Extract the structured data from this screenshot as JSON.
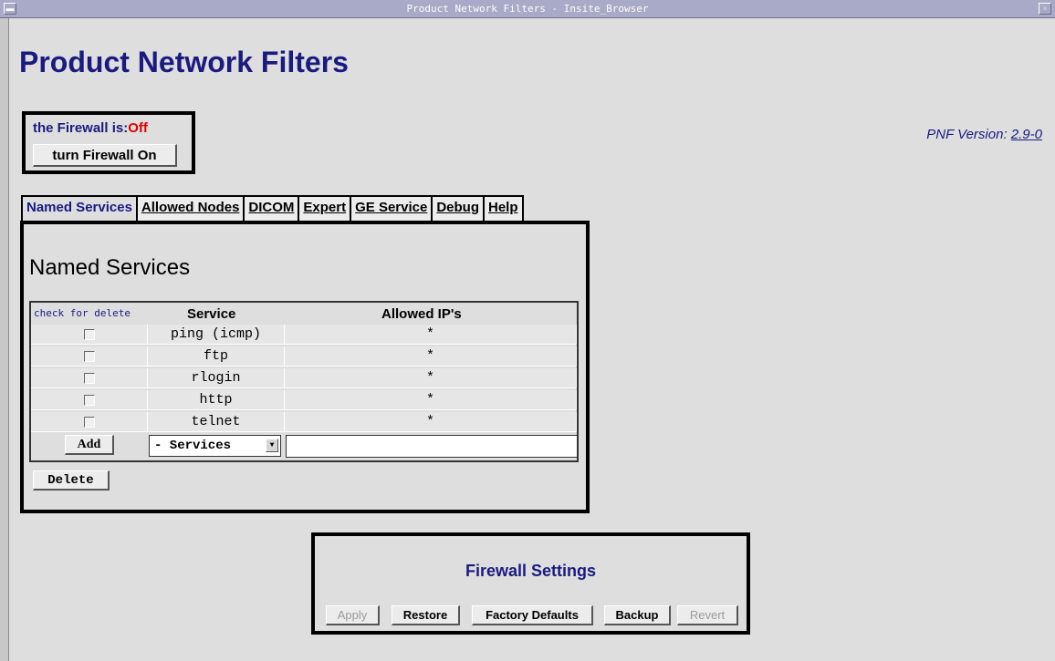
{
  "window": {
    "title": "Product Network Filters - Insite_Browser"
  },
  "page": {
    "title": "Product Network Filters"
  },
  "firewall": {
    "label": "the Firewall is:",
    "state": "Off",
    "toggle_label": "turn Firewall On",
    "state_color": "#e00000"
  },
  "version": {
    "label": "PNF Version:",
    "value": "2.9-0"
  },
  "tabs": [
    {
      "label": "Named Services",
      "active": true
    },
    {
      "label": "Allowed Nodes"
    },
    {
      "label": "DICOM"
    },
    {
      "label": "Expert"
    },
    {
      "label": "GE Service"
    },
    {
      "label": "Debug"
    },
    {
      "label": "Help"
    }
  ],
  "named_services": {
    "heading": "Named Services",
    "columns": {
      "check": "check for delete",
      "service": "Service",
      "ips": "Allowed IP's"
    },
    "rows": [
      {
        "service": "ping (icmp)",
        "ips": "*",
        "checked": false
      },
      {
        "service": "ftp",
        "ips": "*",
        "checked": false
      },
      {
        "service": "rlogin",
        "ips": "*",
        "checked": false
      },
      {
        "service": "http",
        "ips": "*",
        "checked": false
      },
      {
        "service": "telnet",
        "ips": "*",
        "checked": false
      }
    ],
    "add_label": "Add",
    "service_select": "- Services",
    "ip_value": "",
    "delete_label": "Delete"
  },
  "settings": {
    "title": "Firewall Settings",
    "buttons": {
      "apply": "Apply",
      "restore": "Restore",
      "factory": "Factory Defaults",
      "backup": "Backup",
      "revert": "Revert"
    }
  },
  "colors": {
    "accent": "#1a1a80",
    "background": "#dedede"
  }
}
